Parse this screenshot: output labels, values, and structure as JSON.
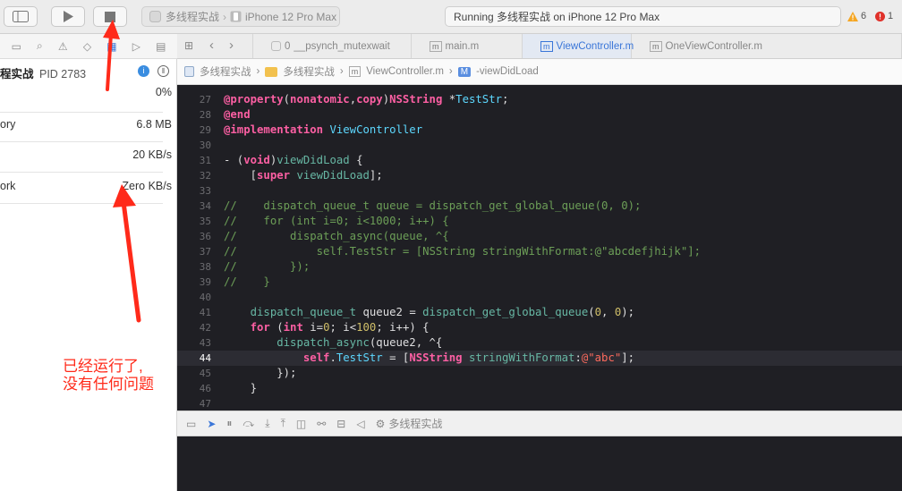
{
  "toolbar": {
    "scheme_name": "多线程实战",
    "device": "iPhone 12 Pro Max",
    "status_text": "Running 多线程实战 on iPhone 12 Pro Max",
    "warnings": "6",
    "errors": "1"
  },
  "debug_navigator": {
    "process_name": "程实战",
    "process_pid": "PID 2783",
    "rows": [
      {
        "label": "",
        "value": "0%"
      },
      {
        "label": "ory",
        "value": "6.8 MB"
      },
      {
        "label": "",
        "value": "20 KB/s"
      },
      {
        "label": "ork",
        "value": "Zero KB/s"
      }
    ]
  },
  "tabs": [
    {
      "label": "__psynch_mutexwait",
      "icon": "thread-icon"
    },
    {
      "label": "main.m",
      "icon": "m-file-icon"
    },
    {
      "label": "ViewController.m",
      "icon": "m-file-icon"
    },
    {
      "label": "OneViewController.m",
      "icon": "m-file-icon"
    }
  ],
  "thread_tab_number": "0",
  "jumpbar": {
    "project": "多线程实战",
    "group": "多线程实战",
    "file": "ViewController.m",
    "method": "-viewDidLoad",
    "method_badge": "M"
  },
  "code_lines": [
    {
      "n": "27",
      "tokens": [
        [
          "kw",
          "@property"
        ],
        [
          "pl",
          "("
        ],
        [
          "kw",
          "nonatomic"
        ],
        [
          "pl",
          ","
        ],
        [
          "kw",
          "copy"
        ],
        [
          "pl",
          ")"
        ],
        [
          "kw",
          "NSString"
        ],
        [
          "pl",
          " *"
        ],
        [
          "ty",
          "TestStr"
        ],
        [
          "pl",
          ";"
        ]
      ]
    },
    {
      "n": "28",
      "tokens": [
        [
          "kw",
          "@end"
        ]
      ]
    },
    {
      "n": "29",
      "tokens": [
        [
          "kw",
          "@implementation"
        ],
        [
          "pl",
          " "
        ],
        [
          "ty",
          "ViewController"
        ]
      ]
    },
    {
      "n": "30",
      "tokens": []
    },
    {
      "n": "31",
      "tokens": [
        [
          "pl",
          "- ("
        ],
        [
          "kw",
          "void"
        ],
        [
          "pl",
          ")"
        ],
        [
          "fn",
          "viewDidLoad"
        ],
        [
          "pl",
          " {"
        ]
      ]
    },
    {
      "n": "32",
      "tokens": [
        [
          "pl",
          "    ["
        ],
        [
          "kw",
          "super"
        ],
        [
          "pl",
          " "
        ],
        [
          "fn",
          "viewDidLoad"
        ],
        [
          "pl",
          "];"
        ]
      ]
    },
    {
      "n": "33",
      "tokens": []
    },
    {
      "n": "34",
      "tokens": [
        [
          "cm",
          "//    dispatch_queue_t queue = dispatch_get_global_queue(0, 0);"
        ]
      ]
    },
    {
      "n": "35",
      "tokens": [
        [
          "cm",
          "//    for (int i=0; i<1000; i++) {"
        ]
      ]
    },
    {
      "n": "36",
      "tokens": [
        [
          "cm",
          "//        dispatch_async(queue, ^{"
        ]
      ]
    },
    {
      "n": "37",
      "tokens": [
        [
          "cm",
          "//            self.TestStr = [NSString stringWithFormat:@\"abcdefjhijk\"];"
        ]
      ]
    },
    {
      "n": "38",
      "tokens": [
        [
          "cm",
          "//        });"
        ]
      ]
    },
    {
      "n": "39",
      "tokens": [
        [
          "cm",
          "//    }"
        ]
      ]
    },
    {
      "n": "40",
      "tokens": []
    },
    {
      "n": "41",
      "tokens": [
        [
          "pl",
          "    "
        ],
        [
          "fn",
          "dispatch_queue_t"
        ],
        [
          "pl",
          " queue2 = "
        ],
        [
          "fn",
          "dispatch_get_global_queue"
        ],
        [
          "pl",
          "("
        ],
        [
          "num",
          "0"
        ],
        [
          "pl",
          ", "
        ],
        [
          "num",
          "0"
        ],
        [
          "pl",
          ");"
        ]
      ]
    },
    {
      "n": "42",
      "tokens": [
        [
          "pl",
          "    "
        ],
        [
          "kw",
          "for"
        ],
        [
          "pl",
          " ("
        ],
        [
          "kw",
          "int"
        ],
        [
          "pl",
          " i="
        ],
        [
          "num",
          "0"
        ],
        [
          "pl",
          "; i<"
        ],
        [
          "num",
          "100"
        ],
        [
          "pl",
          "; i++) {"
        ]
      ]
    },
    {
      "n": "43",
      "tokens": [
        [
          "pl",
          "        "
        ],
        [
          "fn",
          "dispatch_async"
        ],
        [
          "pl",
          "(queue2, ^{"
        ]
      ]
    },
    {
      "n": "44",
      "tokens": [
        [
          "pl",
          "            "
        ],
        [
          "kw",
          "self"
        ],
        [
          "pl",
          "."
        ],
        [
          "ty",
          "TestStr"
        ],
        [
          "pl",
          " = ["
        ],
        [
          "kw",
          "NSString"
        ],
        [
          "pl",
          " "
        ],
        [
          "fn",
          "stringWithFormat"
        ],
        [
          "pl",
          ":"
        ],
        [
          "str",
          "@\"abc\""
        ],
        [
          "pl",
          "];"
        ]
      ]
    },
    {
      "n": "45",
      "tokens": [
        [
          "pl",
          "        });"
        ]
      ]
    },
    {
      "n": "46",
      "tokens": [
        [
          "pl",
          "    }"
        ]
      ]
    },
    {
      "n": "47",
      "tokens": []
    }
  ],
  "current_line": "44",
  "debugbar": {
    "target": "多线程实战"
  },
  "annotation": {
    "line1": "已经运行了,",
    "line2": "没有任何问题"
  },
  "colors": {
    "editor_bg": "#1f1f24",
    "keyword": "#fc5fa3",
    "comment": "#6c9e57",
    "annotation_red": "#ff2a1a",
    "active_tab": "#3a76d8"
  }
}
